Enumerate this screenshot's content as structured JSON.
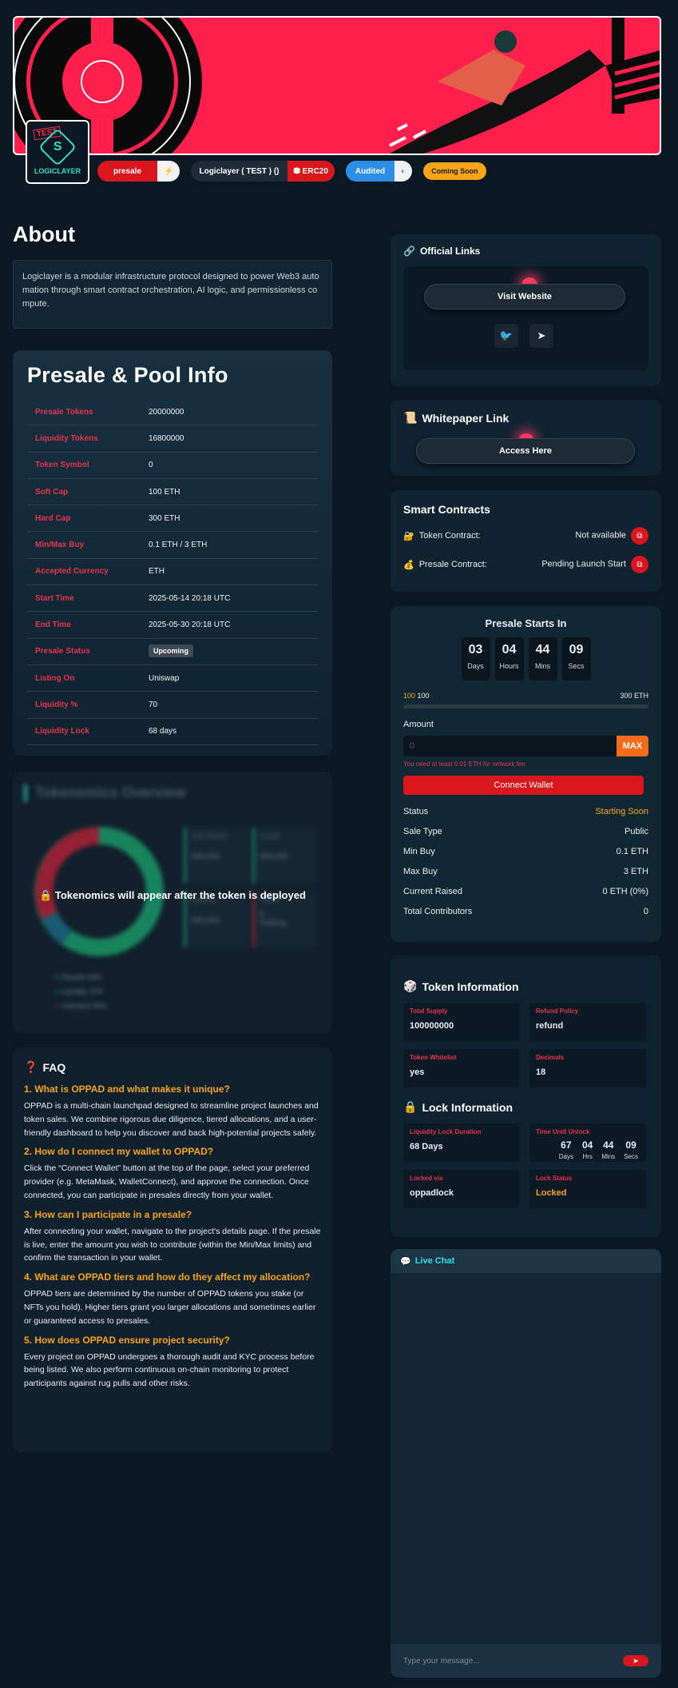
{
  "banner": {
    "alt": "project-banner"
  },
  "logo": {
    "test_stamp": "TEST",
    "letter": "S",
    "name": "LOGICLAYER"
  },
  "badges": {
    "presale": "presale",
    "presale_icon": "⚡",
    "chain_label": "Logiclayer ( TEST ) ()",
    "chain_type": "ERC20",
    "audit": "Audited",
    "audit_icon": "◐",
    "status": "Coming Soon"
  },
  "about": {
    "title": "About",
    "text": "Logiclayer is a modular infrastructure protocol designed to power Web3 automation through smart contract orchestration, AI logic, and permissionless compute."
  },
  "pool": {
    "title": "Presale & Pool Info",
    "rows": [
      {
        "k": "Presale Tokens",
        "v": "20000000"
      },
      {
        "k": "Liquidity Tokens",
        "v": "16800000"
      },
      {
        "k": "Token Symbol",
        "v": "0"
      },
      {
        "k": "Soft Cap",
        "v": "100 ETH"
      },
      {
        "k": "Hard Cap",
        "v": "300 ETH"
      },
      {
        "k": "Min/Max Buy",
        "v": "0.1 ETH / 3 ETH"
      },
      {
        "k": "Accepted Currency",
        "v": "ETH"
      },
      {
        "k": "Start Time",
        "v": "2025-05-14 20:18 UTC"
      },
      {
        "k": "End Time",
        "v": "2025-05-30 20:18 UTC"
      },
      {
        "k": "Presale Status",
        "v": "Upcoming"
      },
      {
        "k": "Listing On",
        "v": "Uniswap"
      },
      {
        "k": "Liquidity %",
        "v": "70"
      },
      {
        "k": "Liquidity Lock",
        "v": "68 days"
      }
    ]
  },
  "tokenomics": {
    "title": "Tokenomics Overview",
    "overlay": "🔒 Tokenomics will appear after the token is deployed",
    "legend": [
      "Presale 44%",
      "Liquidity 11%",
      "Unlocked 45%"
    ],
    "tiles": [
      "Total Raised",
      "Unsold",
      "Liquidity",
      "Tokens"
    ],
    "tile_value": "000,000",
    "tile_value_2": "0",
    "tile_status": "Waiting"
  },
  "faq": {
    "title": "FAQ",
    "icon": "❓",
    "items": [
      {
        "q": "1. What is OPPAD and what makes it unique?",
        "a": "OPPAD is a multi-chain launchpad designed to streamline project launches and token sales. We combine rigorous due diligence, tiered allocations, and a user-friendly dashboard to help you discover and back high-potential projects safely."
      },
      {
        "q": "2. How do I connect my wallet to OPPAD?",
        "a": "Click the “Connect Wallet” button at the top of the page, select your preferred provider (e.g. MetaMask, WalletConnect), and approve the connection. Once connected, you can participate in presales directly from your wallet."
      },
      {
        "q": "3. How can I participate in a presale?",
        "a": "After connecting your wallet, navigate to the project's details page. If the presale is live, enter the amount you wish to contribute (within the Min/Max limits) and confirm the transaction in your wallet."
      },
      {
        "q": "4. What are OPPAD tiers and how do they affect my allocation?",
        "a": "OPPAD tiers are determined by the number of OPPAD tokens you stake (or NFTs you hold). Higher tiers grant you larger allocations and sometimes earlier or guaranteed access to presales."
      },
      {
        "q": "5. How does OPPAD ensure project security?",
        "a": "Every project on OPPAD undergoes a thorough audit and KYC process before being listed. We also perform continuous on-chain monitoring to protect participants against rug pulls and other risks."
      }
    ]
  },
  "links": {
    "title": "Official Links",
    "icon": "🔗",
    "visit": "Visit Website",
    "twitter_icon": "🐦",
    "telegram_icon": "➤"
  },
  "whitepaper": {
    "title": "Whitepaper Link",
    "icon": "📜",
    "button": "Access Here"
  },
  "contracts": {
    "title": "Smart Contracts",
    "token_icon": "🔐",
    "token_label": "Token Contract:",
    "token_value": "Not available",
    "presale_icon": "💰",
    "presale_label": "Presale Contract:",
    "presale_value": "Pending Launch Start",
    "copy_icon": "⧉"
  },
  "presale": {
    "title": "Presale Starts In",
    "countdown": [
      {
        "n": "03",
        "l": "Days"
      },
      {
        "n": "04",
        "l": "Hours"
      },
      {
        "n": "44",
        "l": "Mins"
      },
      {
        "n": "09",
        "l": "Secs"
      }
    ],
    "progress_left_soft": "100",
    "progress_left": "100",
    "progress_right": "300 ETH",
    "progress_fraction": 0,
    "amount_label": "Amount",
    "amount_placeholder": "0",
    "max": "MAX",
    "warning": "You need at least 0.01 ETH for network fee.",
    "connect": "Connect Wallet",
    "stats": [
      {
        "k": "Status",
        "v": "Starting Soon"
      },
      {
        "k": "Sale Type",
        "v": "Public"
      },
      {
        "k": "Min Buy",
        "v": "0.1 ETH"
      },
      {
        "k": "Max Buy",
        "v": "3 ETH"
      },
      {
        "k": "Current Raised",
        "v": "0 ETH (0%)"
      },
      {
        "k": "Total Contributors",
        "v": "0"
      }
    ]
  },
  "token_info": {
    "title": "Token Information",
    "icon": "🎲",
    "cells": [
      {
        "k": "Total Supply",
        "v": "100000000"
      },
      {
        "k": "Refund Policy",
        "v": "refund"
      },
      {
        "k": "Token Whitelist",
        "v": "yes"
      },
      {
        "k": "Decimals",
        "v": "18"
      }
    ],
    "lock_title": "Lock Information",
    "lock_icon": "🔒",
    "lock_duration_label": "Liquidity Lock Duration",
    "lock_duration": "68 Days",
    "unlock_label": "Time Until Unlock",
    "unlock": [
      {
        "n": "67",
        "l": "Days"
      },
      {
        "n": "04",
        "l": "Hrs"
      },
      {
        "n": "44",
        "l": "Mins"
      },
      {
        "n": "09",
        "l": "Secs"
      }
    ],
    "locked_via_label": "Locked via",
    "locked_via": "oppadlock",
    "lock_status_label": "Lock Status",
    "lock_status": "Locked"
  },
  "chat": {
    "title": "Live Chat",
    "icon": "💬",
    "placeholder": "Type your message...",
    "send_icon": "➤"
  }
}
